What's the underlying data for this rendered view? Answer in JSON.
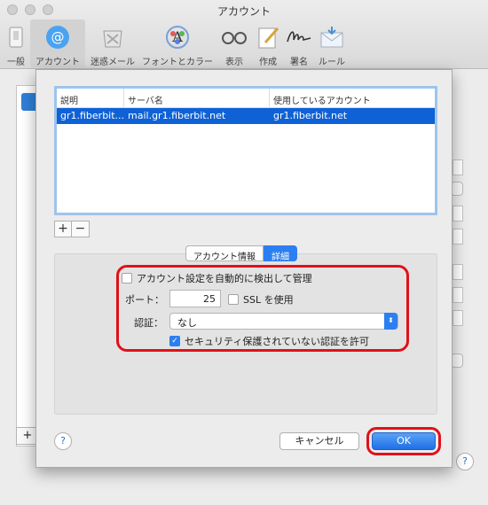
{
  "window": {
    "title": "アカウント"
  },
  "toolbar": {
    "items": [
      {
        "label": "一般",
        "icon": "switch-icon"
      },
      {
        "label": "アカウント",
        "icon": "at-sign-icon"
      },
      {
        "label": "迷惑メール",
        "icon": "junk-mail-icon"
      },
      {
        "label": "フォントとカラー",
        "icon": "fonts-colors-icon"
      },
      {
        "label": "表示",
        "icon": "glasses-icon"
      },
      {
        "label": "作成",
        "icon": "compose-icon"
      },
      {
        "label": "署名",
        "icon": "signature-icon"
      },
      {
        "label": "ルール",
        "icon": "rules-icon"
      }
    ],
    "active_index": 1
  },
  "sheet": {
    "table": {
      "columns": [
        "説明",
        "サーバ名",
        "使用しているアカウント"
      ],
      "rows": [
        {
          "description": "gr1.fiberbit...",
          "server": "mail.gr1.fiberbit.net",
          "account": "gr1.fiberbit.net"
        }
      ]
    },
    "add_label": "+",
    "remove_label": "−",
    "tabs": [
      {
        "label": "アカウント情報"
      },
      {
        "label": "詳細"
      }
    ],
    "selected_tab": "詳細",
    "auto_detect": {
      "label": "アカウント設定を自動的に検出して管理",
      "checked": false
    },
    "port": {
      "label": "ポート：",
      "value": "25"
    },
    "ssl": {
      "label": "SSL を使用",
      "checked": false
    },
    "auth": {
      "label": "認証：",
      "value": "なし"
    },
    "insecure_auth": {
      "label": "セキュリティ保護されていない認証を許可",
      "checked": true
    },
    "help_label": "?",
    "cancel_label": "キャンセル",
    "ok_label": "OK"
  },
  "colors": {
    "accent": "#2c7ff0",
    "highlight": "#e0111a",
    "selection": "#0f62d6"
  }
}
